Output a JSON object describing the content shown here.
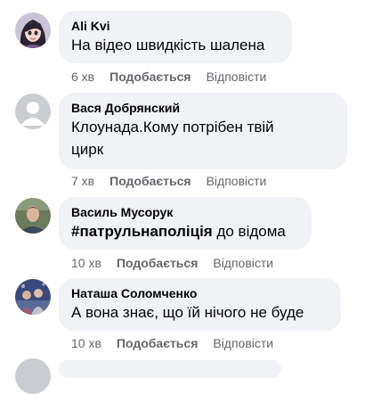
{
  "comments": [
    {
      "author": "Ali Kvi",
      "text": "На відео швидкість шалена",
      "time": "6 хв",
      "like_label": "Подобається",
      "reply_label": "Відповісти",
      "avatar": "cartoon-girl-avatar"
    },
    {
      "author": "Вася Добрянский",
      "text": "Клоунада.Кому потрібен твій\nцирк",
      "time": "7 хв",
      "like_label": "Подобається",
      "reply_label": "Відповісти",
      "avatar": "default-gray-avatar"
    },
    {
      "author": "Василь Мусорук",
      "hashtag": "#патрульнаполіція",
      "text": " до відома",
      "time": "10 хв",
      "like_label": "Подобається",
      "reply_label": "Відповісти",
      "avatar": "man-photo-avatar"
    },
    {
      "author": "Наташа Соломченко",
      "text": "А вона знає, що їй нічого не буде",
      "time": "10 хв",
      "like_label": "Подобається",
      "reply_label": "Відповісти",
      "avatar": "family-photo-avatar"
    }
  ],
  "colors": {
    "bubble": "#f0f2f5",
    "meta_text": "#65676b",
    "text": "#050505"
  }
}
